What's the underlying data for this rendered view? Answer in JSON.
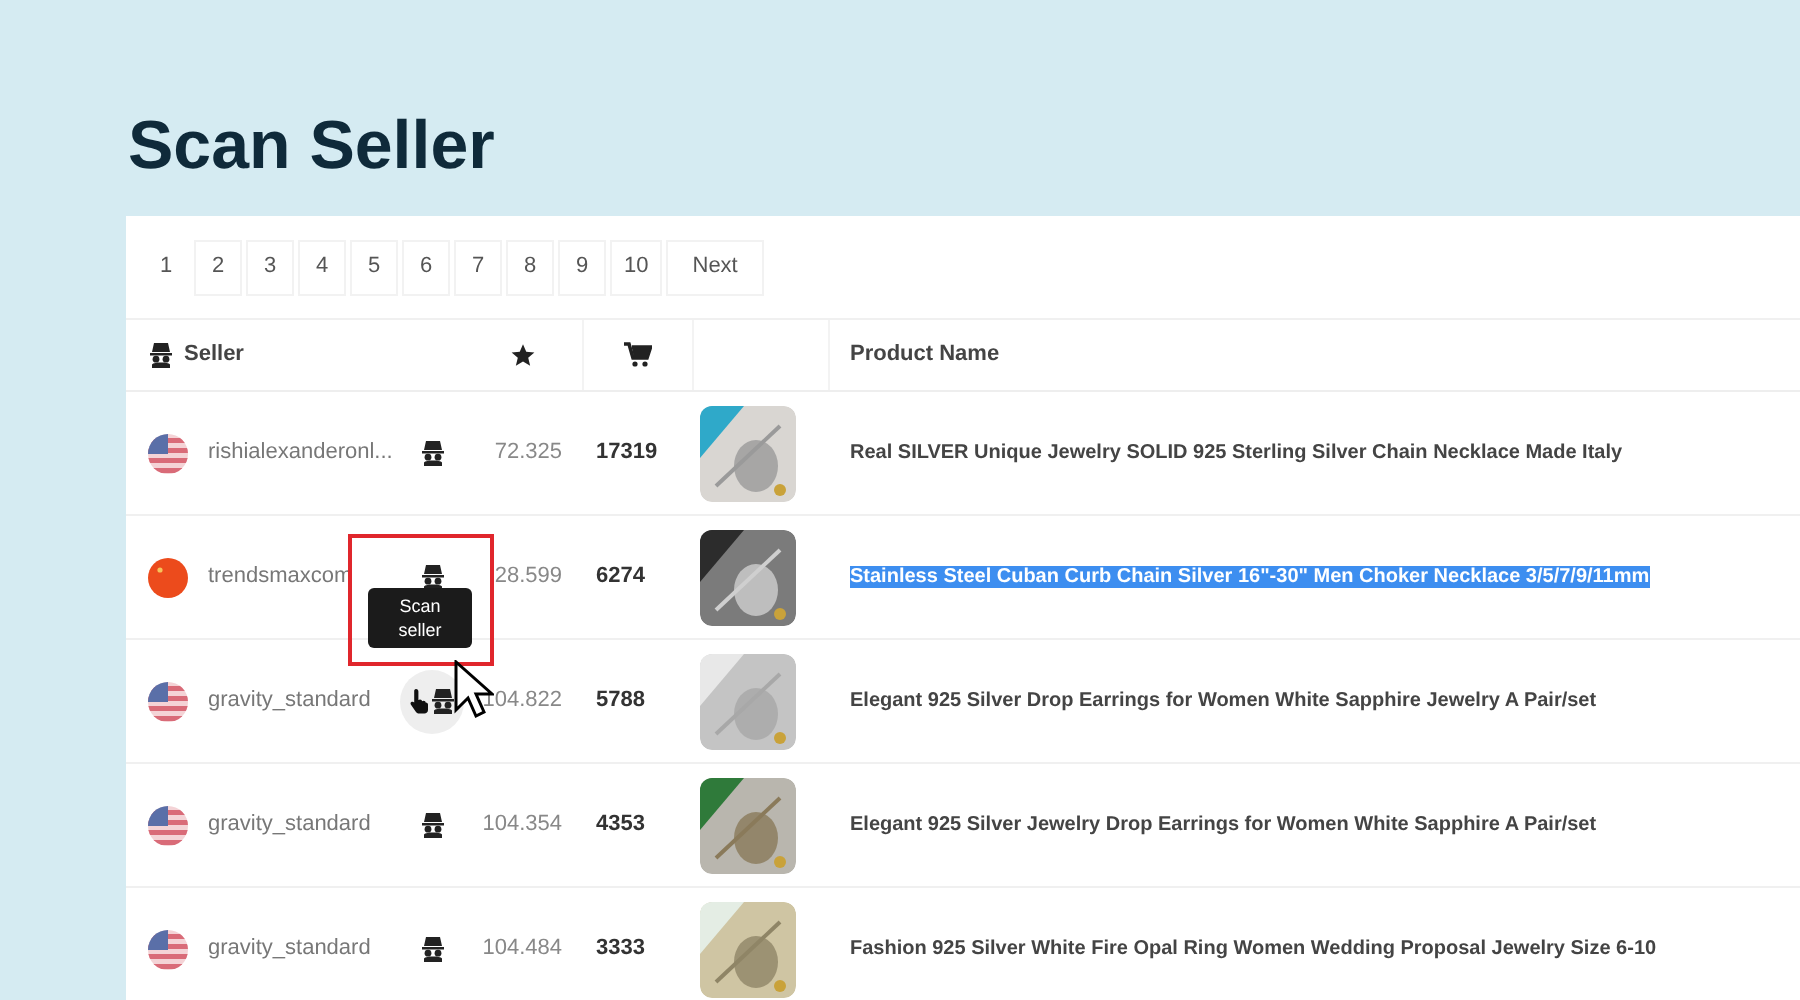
{
  "title": "Scan Seller",
  "pagination": [
    {
      "label": "1",
      "selected": true
    },
    {
      "label": "2",
      "selected": false
    },
    {
      "label": "3",
      "selected": false
    },
    {
      "label": "4",
      "selected": false
    },
    {
      "label": "5",
      "selected": false
    },
    {
      "label": "6",
      "selected": false
    },
    {
      "label": "7",
      "selected": false
    },
    {
      "label": "8",
      "selected": false
    },
    {
      "label": "9",
      "selected": false
    },
    {
      "label": "10",
      "selected": false
    },
    {
      "label": "Next",
      "selected": false
    }
  ],
  "table": {
    "columns": [
      "Seller",
      "Product Name"
    ],
    "rows": [
      {
        "kind": "us",
        "seller": "rishialexanderonl...",
        "rating": "72.325",
        "sales": "17319",
        "product": "Real SILVER Unique Jewelry SOLID 925 Sterling Silver Chain Necklace Made Italy",
        "highlighted": false,
        "hovered": false
      },
      {
        "kind": "cn",
        "seller": "trendsmaxcom",
        "rating": "28.599",
        "sales": "6274",
        "product": "Stainless Steel Cuban Curb Chain Silver 16\"-30\" Men Choker Necklace 3/5/7/9/11mm",
        "highlighted": true,
        "hovered": false,
        "tooltip": "Scan seller",
        "framed": true
      },
      {
        "kind": "us",
        "seller": "gravity_standard",
        "rating": "104.822",
        "sales": "5788",
        "product": "Elegant 925 Silver Drop Earrings for Women White Sapphire Jewelry A Pair/set",
        "highlighted": false,
        "hovered": true
      },
      {
        "kind": "us",
        "seller": "gravity_standard",
        "rating": "104.354",
        "sales": "4353",
        "product": "Elegant 925 Silver Jewelry Drop Earrings for Women White Sapphire A Pair/set",
        "highlighted": false,
        "hovered": false
      },
      {
        "kind": "us",
        "seller": "gravity_standard",
        "rating": "104.484",
        "sales": "3333",
        "product": "Fashion 925 Silver White Fire Opal Ring Women Wedding Proposal Jewelry Size 6-10",
        "highlighted": false,
        "hovered": false
      }
    ]
  }
}
